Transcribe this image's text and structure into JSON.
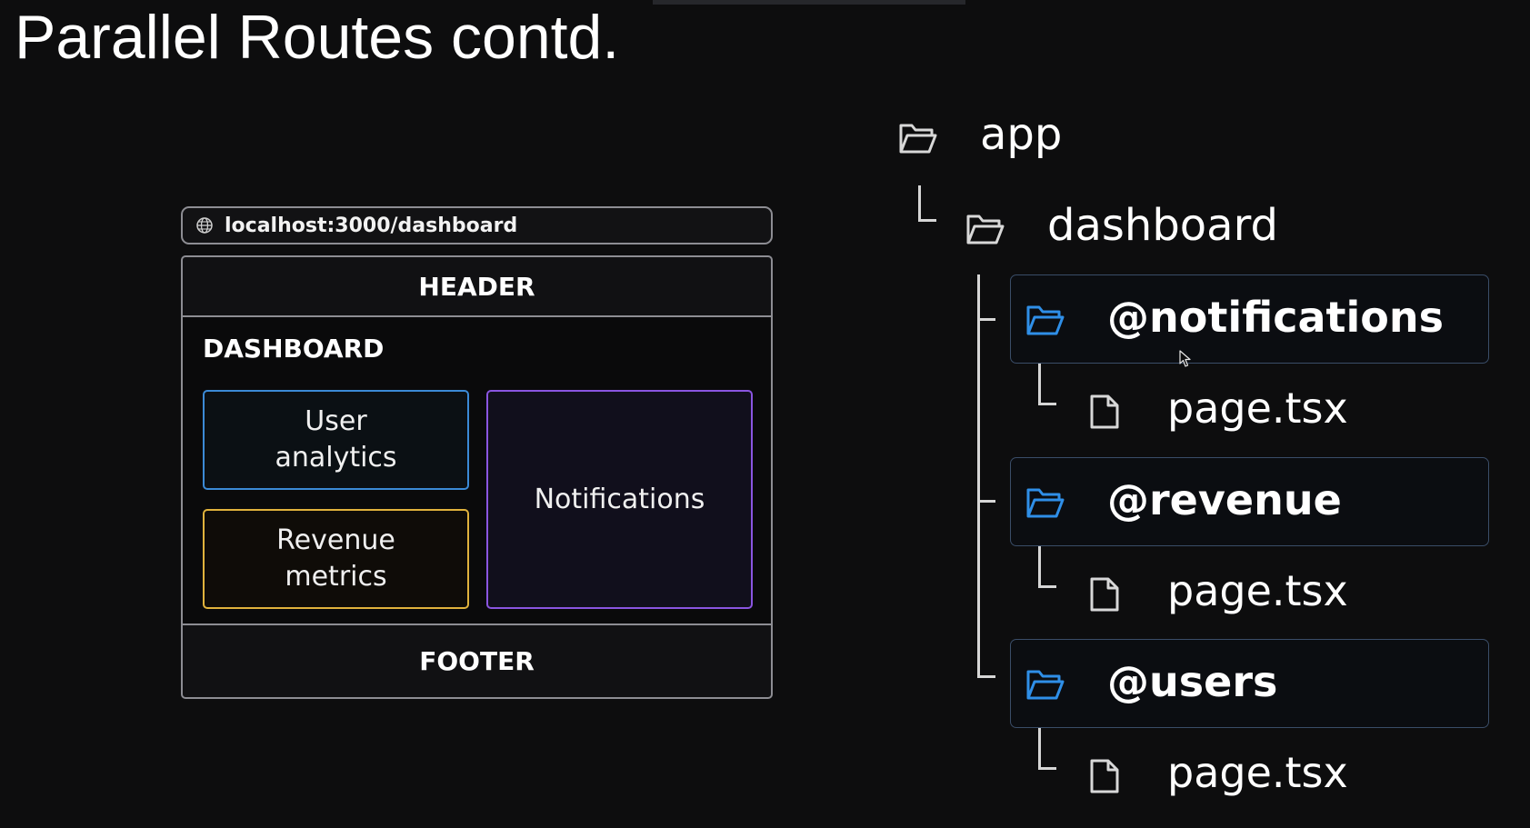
{
  "slide": {
    "title": "Parallel Routes contd."
  },
  "browser": {
    "url": "localhost:3000/dashboard",
    "header_label": "HEADER",
    "dashboard_label": "DASHBOARD",
    "slots": {
      "analytics": "User\nanalytics",
      "revenue": "Revenue\nmetrics",
      "notifications": "Notifications"
    },
    "footer_label": "FOOTER"
  },
  "tree": {
    "root": "app",
    "dashboard": "dashboard",
    "slots": [
      {
        "name": "@notifications",
        "file": "page.tsx"
      },
      {
        "name": "@revenue",
        "file": "page.tsx"
      },
      {
        "name": "@users",
        "file": "page.tsx"
      }
    ]
  },
  "colors": {
    "analytics_border": "#3b8ad6",
    "revenue_border": "#e0b23c",
    "notifications_border": "#8a55e0",
    "slot_folder_icon": "#2f8fe8",
    "background": "#0d0d0e"
  },
  "icons": [
    "globe-icon",
    "folder-open-icon",
    "file-icon",
    "mouse-cursor-icon"
  ]
}
